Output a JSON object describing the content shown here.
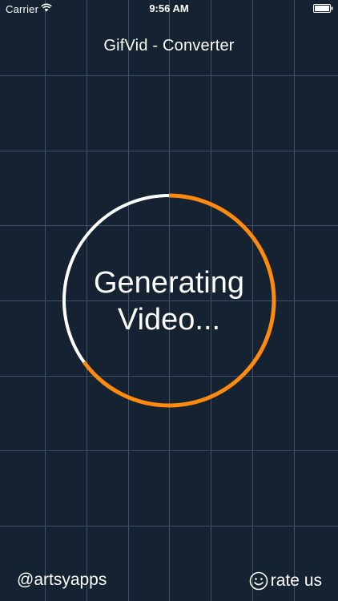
{
  "status_bar": {
    "carrier": "Carrier",
    "time": "9:56 AM"
  },
  "app": {
    "title": "GifVid - Converter"
  },
  "progress": {
    "line1": "Generating",
    "line2": "Video...",
    "fraction": 0.65,
    "progress_color": "#ff8a0d",
    "track_color": "#ffffff"
  },
  "footer": {
    "developer": "@artsyapps",
    "rate_label": "rate us"
  },
  "icons": {
    "wifi": "wifi-icon",
    "battery": "battery-icon",
    "rate": "smiley-icon"
  },
  "theme": {
    "background": "#142231",
    "grid": "#3e5263"
  }
}
